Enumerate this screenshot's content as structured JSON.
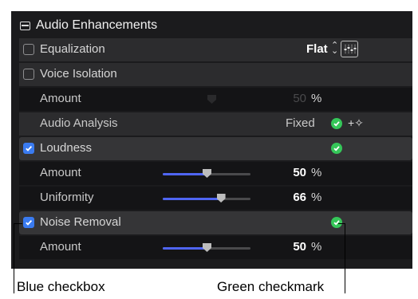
{
  "header": {
    "title": "Audio Enhancements"
  },
  "rows": {
    "equalization": {
      "label": "Equalization",
      "preset": "Flat",
      "arrows": "⌃⌄"
    },
    "voice_isolation": {
      "label": "Voice Isolation"
    },
    "vi_amount": {
      "label": "Amount",
      "value": "50",
      "unit": "%"
    },
    "audio_analysis": {
      "label": "Audio Analysis",
      "status": "Fixed",
      "wand": "+✧"
    },
    "loudness": {
      "label": "Loudness"
    },
    "loud_amount": {
      "label": "Amount",
      "value": "50",
      "unit": "%",
      "level": 0.5
    },
    "uniformity": {
      "label": "Uniformity",
      "value": "66",
      "unit": "%",
      "level": 0.66
    },
    "noise_removal": {
      "label": "Noise Removal"
    },
    "nr_amount": {
      "label": "Amount",
      "value": "50",
      "unit": "%",
      "level": 0.5
    }
  },
  "callouts": {
    "checkbox": "Blue checkbox",
    "checkmark": "Green checkmark"
  },
  "colors": {
    "panel": "#1b1b1d",
    "checkbox_blue": "#3a7bf0",
    "check_green": "#35c759",
    "slider_blue": "#4f65f2"
  }
}
